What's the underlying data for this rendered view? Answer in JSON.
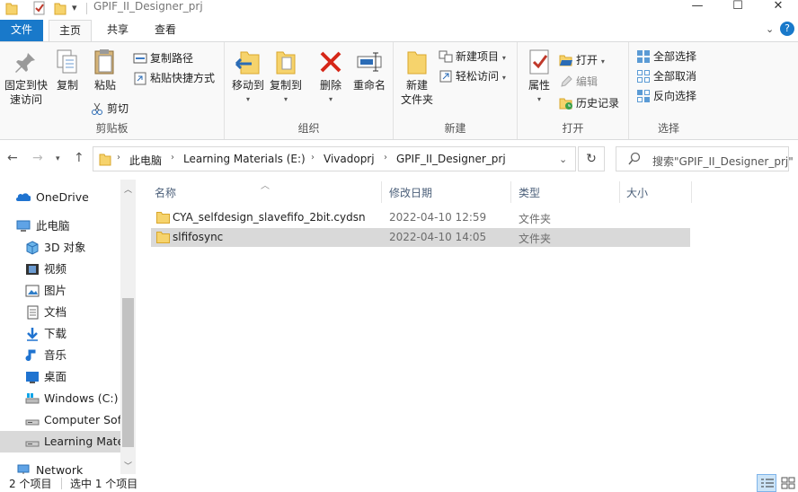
{
  "window": {
    "title": "GPIF_II_Designer_prj",
    "minimize": "—",
    "maximize": "☐",
    "close": "✕"
  },
  "tabs": {
    "file": "文件",
    "home": "主页",
    "share": "共享",
    "view": "查看"
  },
  "ribbon": {
    "clipboard": {
      "label": "剪贴板",
      "pin": "固定到快\n速访问",
      "pin_line1": "固定到快",
      "pin_line2": "速访问",
      "copy": "复制",
      "paste": "粘贴",
      "copy_path": "复制路径",
      "paste_shortcut": "粘贴快捷方式",
      "cut": "剪切"
    },
    "organize": {
      "label": "组织",
      "move_to": "移动到",
      "copy_to": "复制到",
      "delete": "删除",
      "rename": "重命名"
    },
    "new": {
      "label": "新建",
      "new_folder_line1": "新建",
      "new_folder_line2": "文件夹",
      "new_item": "新建项目",
      "easy_access": "轻松访问"
    },
    "open": {
      "label": "打开",
      "properties": "属性",
      "open": "打开",
      "edit": "编辑",
      "history": "历史记录"
    },
    "select": {
      "label": "选择",
      "select_all": "全部选择",
      "select_none": "全部取消",
      "invert": "反向选择"
    }
  },
  "address": {
    "crumbs": [
      "此电脑",
      "Learning Materials (E:)",
      "Vivadoprj",
      "GPIF_II_Designer_prj"
    ]
  },
  "search": {
    "placeholder": "搜索\"GPIF_II_Designer_prj\""
  },
  "nav": {
    "items": [
      {
        "label": "OneDrive",
        "icon": "cloud-icon"
      },
      {
        "label": "此电脑",
        "icon": "computer-icon"
      },
      {
        "label": "3D 对象",
        "icon": "cube-icon"
      },
      {
        "label": "视频",
        "icon": "video-icon"
      },
      {
        "label": "图片",
        "icon": "picture-icon"
      },
      {
        "label": "文档",
        "icon": "document-icon"
      },
      {
        "label": "下载",
        "icon": "download-icon"
      },
      {
        "label": "音乐",
        "icon": "music-icon"
      },
      {
        "label": "桌面",
        "icon": "desktop-icon"
      },
      {
        "label": "Windows (C:)",
        "icon": "drive-icon"
      },
      {
        "label": "Computer Soft",
        "icon": "drive-icon"
      },
      {
        "label": "Learning Mate",
        "icon": "drive-icon"
      },
      {
        "label": "Network",
        "icon": "network-icon"
      }
    ]
  },
  "columns": {
    "name": "名称",
    "date": "修改日期",
    "type": "类型",
    "size": "大小"
  },
  "files": [
    {
      "name": "CYA_selfdesign_slavefifo_2bit.cydsn",
      "date": "2022-04-10 12:59",
      "type": "文件夹",
      "selected": false
    },
    {
      "name": "slfifosync",
      "date": "2022-04-10 14:05",
      "type": "文件夹",
      "selected": true
    }
  ],
  "status": {
    "count": "2 个项目",
    "selection": "选中 1 个项目"
  },
  "colors": {
    "accent": "#1979ca",
    "folder": "#f6d36c",
    "selection": "#d9d9d9"
  }
}
